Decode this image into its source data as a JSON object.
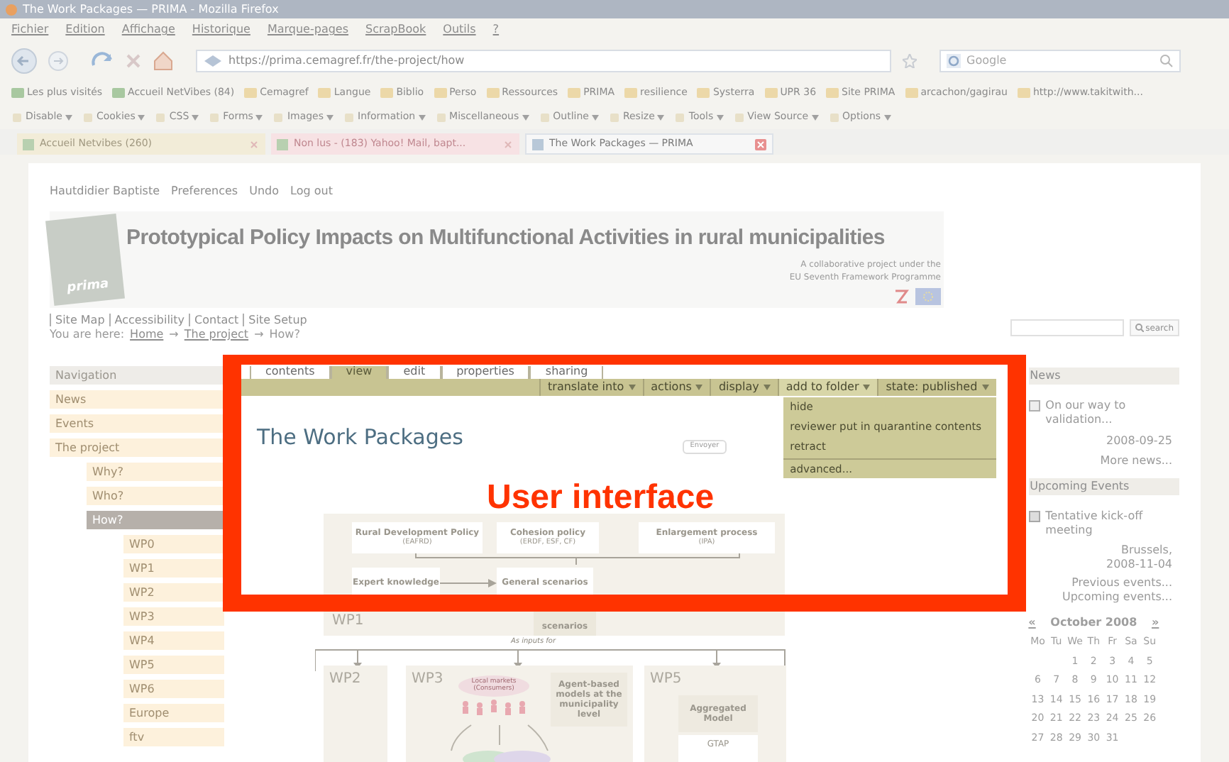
{
  "window": {
    "title": "The Work Packages — PRIMA - Mozilla Firefox"
  },
  "menu": [
    "Fichier",
    "Edition",
    "Affichage",
    "Historique",
    "Marque-pages",
    "ScrapBook",
    "Outils",
    "?"
  ],
  "address": "https://prima.cemagref.fr/the-project/how",
  "search": {
    "placeholder": "Google"
  },
  "bookmarks": [
    "Les plus visités",
    "Accueil NetVibes (84)",
    "Cemagref",
    "Langue",
    "Biblio",
    "Perso",
    "Ressources",
    "PRIMA",
    "resilience",
    "Systerra",
    "UPR 36",
    "Site PRIMA",
    "arcachon/gagirau",
    "http://www.takitwith..."
  ],
  "dev_toolbar": [
    "Disable",
    "Cookies",
    "CSS",
    "Forms",
    "Images",
    "Information",
    "Miscellaneous",
    "Outline",
    "Resize",
    "Tools",
    "View Source",
    "Options"
  ],
  "browser_tabs": [
    {
      "label": "Accueil Netvibes (260)",
      "selected": false
    },
    {
      "label": "Non lus - (183) Yahoo! Mail, bapt...",
      "selected": false
    },
    {
      "label": "The Work Packages — PRIMA",
      "selected": true
    }
  ],
  "user_links": [
    "Hautdidier Baptiste",
    "Preferences",
    "Undo",
    "Log out"
  ],
  "site": {
    "title": "Prototypical Policy Impacts on Multifunctional Activities in rural municipalities",
    "subtitle": [
      "A collaborative project under the",
      "EU Seventh Framework Programme"
    ],
    "logo_text": "prima"
  },
  "site_actions": [
    "Site Map",
    "Accessibility",
    "Contact",
    "Site Setup"
  ],
  "breadcrumb": {
    "prefix": "You are here:",
    "links": [
      "Home",
      "The project"
    ],
    "current": "How?",
    "separator": "→"
  },
  "search_button": "search",
  "navigation": {
    "heading": "Navigation",
    "items": [
      {
        "label": "News",
        "selected": false
      },
      {
        "label": "Events",
        "selected": false
      },
      {
        "label": "The project",
        "selected": false,
        "children": [
          {
            "label": "Why?",
            "selected": false
          },
          {
            "label": "Who?",
            "selected": false
          },
          {
            "label": "How?",
            "selected": true,
            "children": [
              {
                "label": "WP0",
                "selected": false
              },
              {
                "label": "WP1",
                "selected": false
              },
              {
                "label": "WP2",
                "selected": false
              },
              {
                "label": "WP3",
                "selected": false
              },
              {
                "label": "WP4",
                "selected": false
              },
              {
                "label": "WP5",
                "selected": false
              },
              {
                "label": "WP6",
                "selected": false
              },
              {
                "label": "Europe",
                "selected": false
              },
              {
                "label": "ftv",
                "selected": false
              }
            ]
          }
        ]
      }
    ]
  },
  "content_tabs": [
    {
      "label": "contents",
      "selected": false
    },
    {
      "label": "view",
      "selected": true
    },
    {
      "label": "edit",
      "selected": false
    },
    {
      "label": "properties",
      "selected": false
    },
    {
      "label": "sharing",
      "selected": false
    }
  ],
  "content_actions": [
    {
      "label": "translate into",
      "open": false
    },
    {
      "label": "actions",
      "open": false
    },
    {
      "label": "display",
      "open": false
    },
    {
      "label": "add to folder",
      "open": true
    },
    {
      "label": "state: published",
      "open": false
    }
  ],
  "state_menu": [
    "hide",
    "reviewer put in quarantine contents",
    "retract",
    "advanced..."
  ],
  "page_title": "The Work Packages",
  "send_button": "Envoyer",
  "diagram": {
    "policies": [
      {
        "name": "Rural Development Policy",
        "sub": "(EAFRD)"
      },
      {
        "name": "Cohesion policy",
        "sub": "(ERDF, ESF, CF)"
      },
      {
        "name": "Enlargement process",
        "sub": "(IPA)"
      }
    ],
    "expert": "Expert knowledge",
    "general": "General scenarios",
    "wp1": "WP1",
    "scenarios": "scenarios",
    "inputs": "As inputs for",
    "wp2": "WP2",
    "wp3": "WP3",
    "wp5": "WP5",
    "markets": "Local markets (Consumers)",
    "agents": "Agent-based models at the municipality level",
    "aggregated": "Aggregated Model",
    "gtap": "GTAP"
  },
  "news": {
    "heading": "News",
    "items": [
      {
        "title": "On our way to validation...",
        "date": "2008-09-25"
      }
    ],
    "more": "More news..."
  },
  "events": {
    "heading": "Upcoming Events",
    "items": [
      {
        "title": "Tentative kick-off meeting",
        "place": "Brussels,",
        "date": "2008-11-04"
      }
    ],
    "previous": "Previous events...",
    "upcoming": "Upcoming events..."
  },
  "calendar": {
    "prev": "«",
    "month": "October 2008",
    "next": "»",
    "weekdays": [
      "Mo",
      "Tu",
      "We",
      "Th",
      "Fr",
      "Sa",
      "Su"
    ],
    "weeks": [
      [
        "1",
        "2",
        "3",
        "4",
        "5"
      ],
      [
        "6",
        "7",
        "8",
        "9",
        "10",
        "11",
        "12"
      ],
      [
        "13",
        "14",
        "15",
        "16",
        "17",
        "18",
        "19"
      ],
      [
        "20",
        "21",
        "22",
        "23",
        "24",
        "25",
        "26"
      ],
      [
        "27",
        "28",
        "29",
        "30",
        "31"
      ]
    ]
  },
  "annotation": "User interface"
}
